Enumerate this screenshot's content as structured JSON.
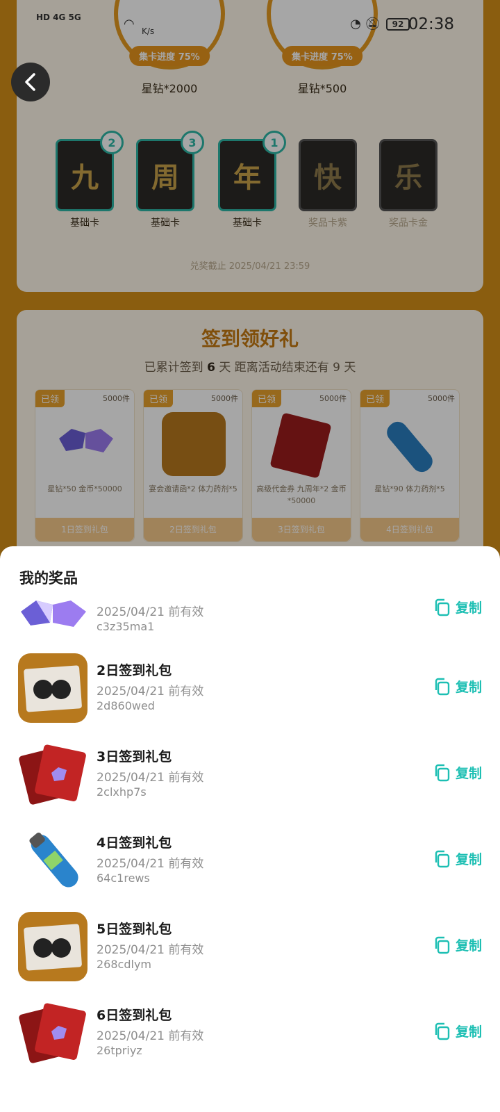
{
  "status_bar": {
    "network": "HD 4G 5G",
    "speed": "K/s",
    "battery": "92",
    "time": "02:38"
  },
  "collect": {
    "prizes": [
      {
        "progress": "集卡进度 75%",
        "label": "星钻*2000"
      },
      {
        "progress": "集卡进度 75%",
        "label": "星钻*500"
      }
    ],
    "cards": [
      {
        "char": "九",
        "label": "基础卡",
        "count": "2",
        "owned": true
      },
      {
        "char": "周",
        "label": "基础卡",
        "count": "3",
        "owned": true
      },
      {
        "char": "年",
        "label": "基础卡",
        "count": "1",
        "owned": true
      },
      {
        "char": "快",
        "label": "奖品卡紫",
        "count": "",
        "owned": false
      },
      {
        "char": "乐",
        "label": "奖品卡金",
        "count": "",
        "owned": false
      }
    ],
    "deadline": "兑奖截止 2025/04/21 23:59"
  },
  "signin": {
    "title": "签到领好礼",
    "sub_prefix": "已累计签到",
    "sub_days": "6",
    "sub_suffix": "天  距离活动结束还有 9 天",
    "gifts": [
      {
        "tag": "已领",
        "count": "5000件",
        "desc": "星钻*50 金币*50000",
        "foot": "1日签到礼包"
      },
      {
        "tag": "已领",
        "count": "5000件",
        "desc": "宴会邀请函*2 体力药剂*5",
        "foot": "2日签到礼包"
      },
      {
        "tag": "已领",
        "count": "5000件",
        "desc": "高级代金券 九周年*2 金币*50000",
        "foot": "3日签到礼包"
      },
      {
        "tag": "已领",
        "count": "5000件",
        "desc": "星钻*90 体力药剂*5",
        "foot": "4日签到礼包"
      }
    ]
  },
  "sheet": {
    "title": "我的奖品",
    "copy_label": "复制",
    "items": [
      {
        "title": "",
        "date": "2025/04/21 前有效",
        "code": "c3z35ma1",
        "icon": "gem-icon"
      },
      {
        "title": "2日签到礼包",
        "date": "2025/04/21 前有效",
        "code": "2d860wed",
        "icon": "invitation-icon"
      },
      {
        "title": "3日签到礼包",
        "date": "2025/04/21 前有效",
        "code": "2clxhp7s",
        "icon": "voucher-icon"
      },
      {
        "title": "4日签到礼包",
        "date": "2025/04/21 前有效",
        "code": "64c1rews",
        "icon": "potion-icon"
      },
      {
        "title": "5日签到礼包",
        "date": "2025/04/21 前有效",
        "code": "268cdlym",
        "icon": "invitation-icon"
      },
      {
        "title": "6日签到礼包",
        "date": "2025/04/21 前有效",
        "code": "26tpriyz",
        "icon": "voucher-icon"
      }
    ]
  },
  "colors": {
    "accent": "#1dbfb3",
    "orange": "#d48f17"
  }
}
